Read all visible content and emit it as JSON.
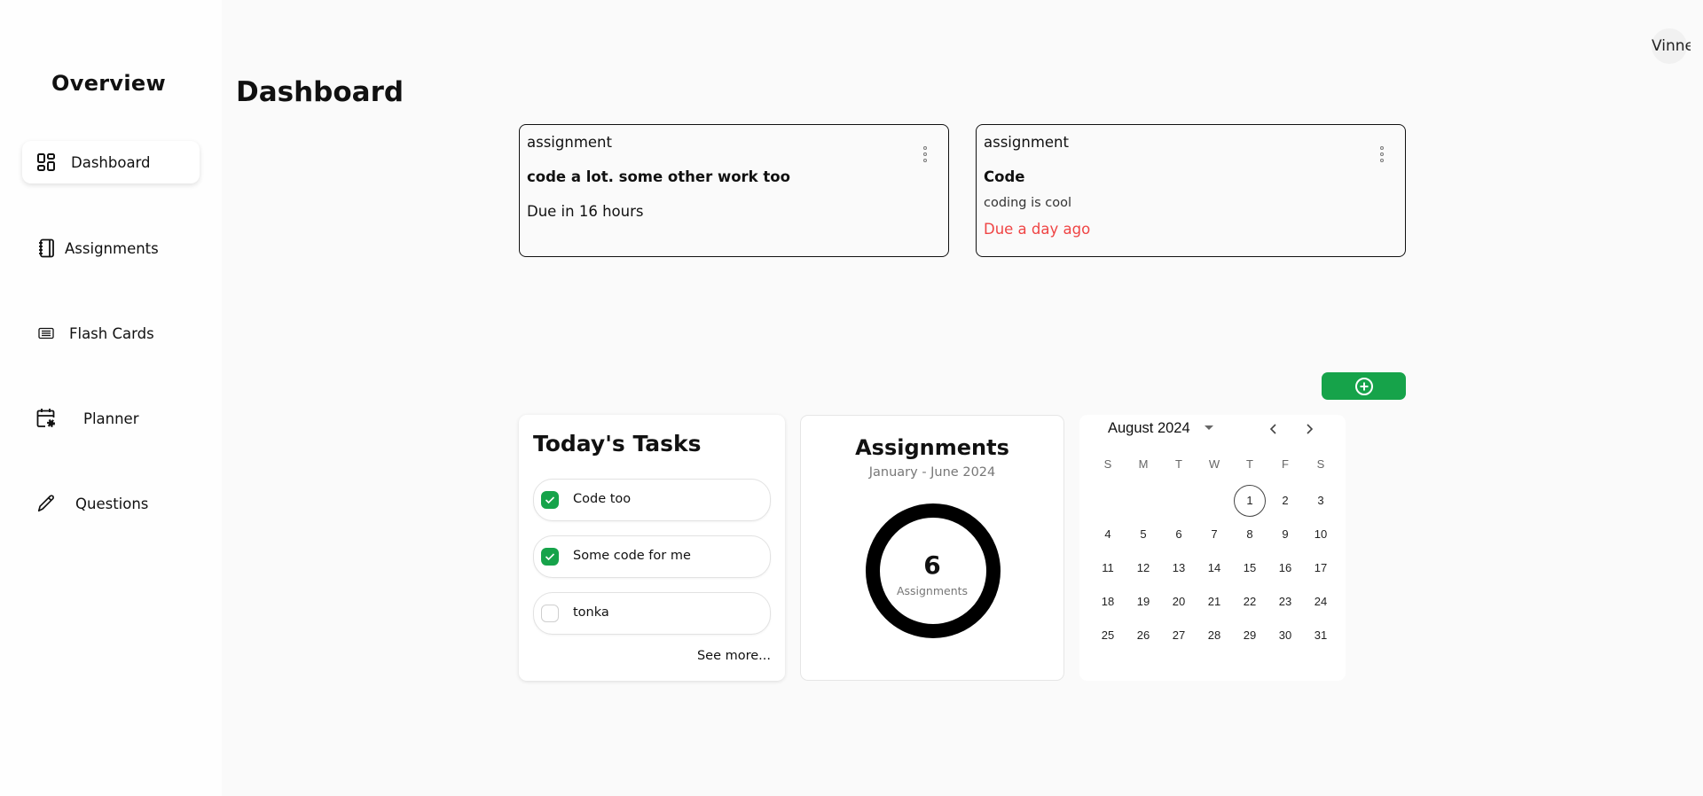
{
  "sidebar": {
    "title": "Overview",
    "items": [
      {
        "label": "Dashboard",
        "icon": "dashboard-grid-icon",
        "active": true
      },
      {
        "label": "Assignments",
        "icon": "notebook-icon"
      },
      {
        "label": "Flash Cards",
        "icon": "list-card-icon"
      },
      {
        "label": "Planner",
        "icon": "calendar-gear-icon"
      },
      {
        "label": "Questions",
        "icon": "pencil-icon"
      }
    ]
  },
  "header": {
    "title": "Dashboard",
    "user_name": "Vinne"
  },
  "assignments": [
    {
      "type": "assignment",
      "title": "code a lot. some other work too",
      "description": "",
      "due": "Due in 16 hours",
      "overdue": false
    },
    {
      "type": "assignment",
      "title": "Code",
      "description": "coding is cool",
      "due": "Due a day ago",
      "overdue": true
    }
  ],
  "add_button": {
    "icon": "plus-circle-icon"
  },
  "tasks": {
    "title": "Today's Tasks",
    "items": [
      {
        "label": "Code too",
        "done": true
      },
      {
        "label": "Some code for me",
        "done": true
      },
      {
        "label": "tonka",
        "done": false
      }
    ],
    "see_more": "See more..."
  },
  "stats": {
    "title": "Assignments",
    "subtitle": "January - June 2024",
    "count": "6",
    "count_label": "Assignments"
  },
  "calendar": {
    "month_label": "August 2024",
    "weekdays": [
      "S",
      "M",
      "T",
      "W",
      "T",
      "F",
      "S"
    ],
    "weeks": [
      [
        "",
        "",
        "",
        "",
        "1",
        "2",
        "3"
      ],
      [
        "4",
        "5",
        "6",
        "7",
        "8",
        "9",
        "10"
      ],
      [
        "11",
        "12",
        "13",
        "14",
        "15",
        "16",
        "17"
      ],
      [
        "18",
        "19",
        "20",
        "21",
        "22",
        "23",
        "24"
      ],
      [
        "25",
        "26",
        "27",
        "28",
        "29",
        "30",
        "31"
      ]
    ],
    "selected_day": "1"
  },
  "colors": {
    "accent_green": "#16a34a",
    "overdue_red": "#ef4444"
  }
}
